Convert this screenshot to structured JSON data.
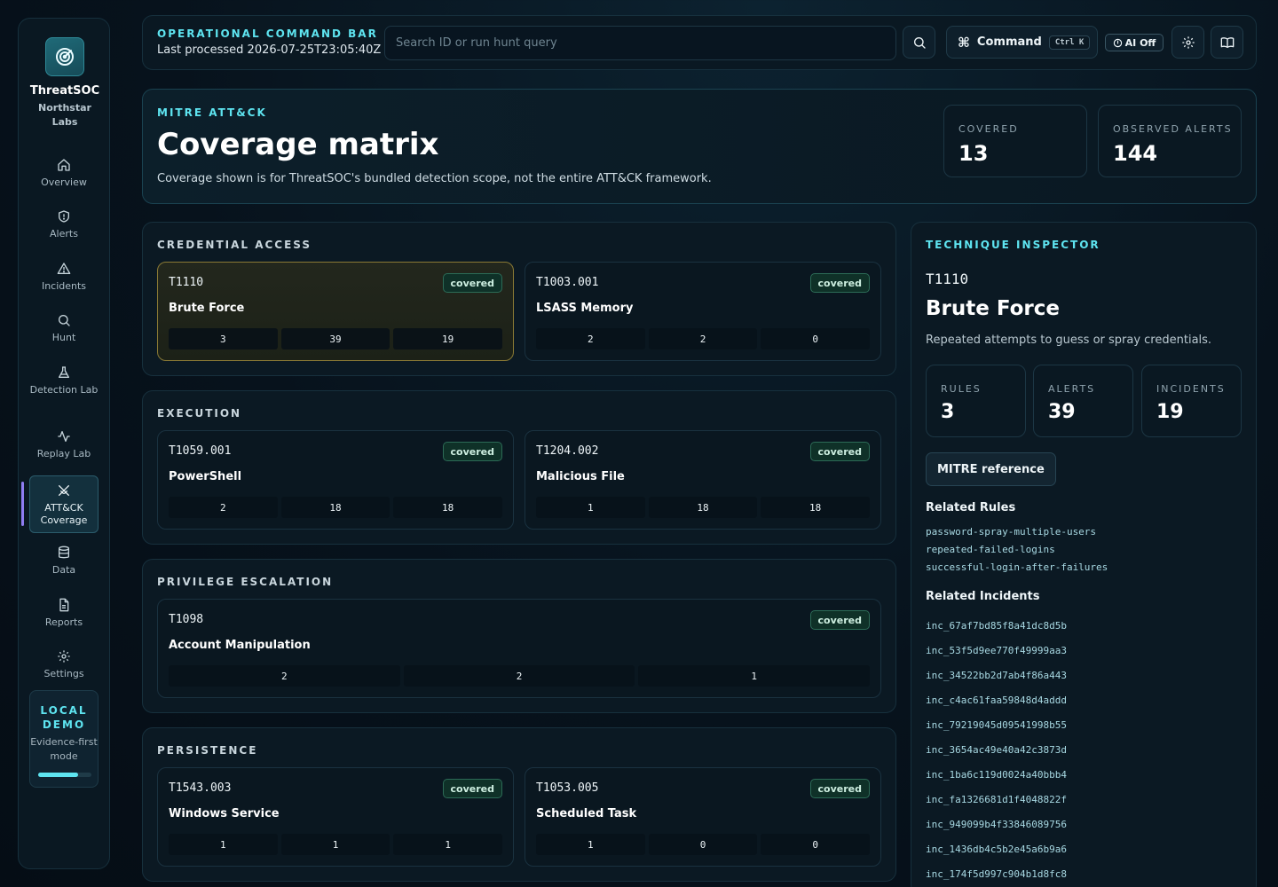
{
  "brand": {
    "name": "ThreatSOC",
    "org_line1": "Northstar",
    "org_line2": "Labs"
  },
  "nav": [
    {
      "label": "Overview",
      "icon": "home-icon"
    },
    {
      "label": "Alerts",
      "icon": "shield-icon"
    },
    {
      "label": "Incidents",
      "icon": "warning-icon"
    },
    {
      "label": "Hunt",
      "icon": "search-icon"
    },
    {
      "label": "Detection Lab",
      "icon": "flask-icon"
    },
    {
      "label": "Replay Lab",
      "icon": "activity-icon"
    },
    {
      "label": "ATT&CK Coverage",
      "icon": "swords-icon",
      "active": true
    },
    {
      "label": "Data",
      "icon": "database-icon"
    },
    {
      "label": "Reports",
      "icon": "file-icon"
    },
    {
      "label": "Settings",
      "icon": "gear-icon"
    }
  ],
  "demo": {
    "title": "LOCAL DEMO",
    "subtitle": "Evidence-first mode",
    "progress": 0.75
  },
  "topbar": {
    "title": "OPERATIONAL COMMAND BAR",
    "last_processed": "Last processed 2026-07-25T23:05:40Z",
    "search_placeholder": "Search ID or run hunt query",
    "command_label": "Command",
    "command_shortcut": "Ctrl K",
    "ai_label": "AI Off"
  },
  "hero": {
    "tag": "MITRE ATT&CK",
    "title": "Coverage matrix",
    "description": "Coverage shown is for ThreatSOC's bundled detection scope, not the entire ATT&CK framework.",
    "stats": [
      {
        "label": "COVERED",
        "value": "13"
      },
      {
        "label": "OBSERVED ALERTS",
        "value": "144"
      }
    ]
  },
  "tactics": [
    {
      "name": "CREDENTIAL ACCESS",
      "techniques": [
        {
          "id": "T1110",
          "name": "Brute Force",
          "status": "covered",
          "metrics": [
            "3",
            "39",
            "19"
          ],
          "selected": true
        },
        {
          "id": "T1003.001",
          "name": "LSASS Memory",
          "status": "covered",
          "metrics": [
            "2",
            "2",
            "0"
          ]
        }
      ]
    },
    {
      "name": "EXECUTION",
      "techniques": [
        {
          "id": "T1059.001",
          "name": "PowerShell",
          "status": "covered",
          "metrics": [
            "2",
            "18",
            "18"
          ]
        },
        {
          "id": "T1204.002",
          "name": "Malicious File",
          "status": "covered",
          "metrics": [
            "1",
            "18",
            "18"
          ]
        }
      ]
    },
    {
      "name": "PRIVILEGE ESCALATION",
      "techniques": [
        {
          "id": "T1098",
          "name": "Account Manipulation",
          "status": "covered",
          "metrics": [
            "2",
            "2",
            "1"
          ]
        }
      ]
    },
    {
      "name": "PERSISTENCE",
      "techniques": [
        {
          "id": "T1543.003",
          "name": "Windows Service",
          "status": "covered",
          "metrics": [
            "1",
            "1",
            "1"
          ]
        },
        {
          "id": "T1053.005",
          "name": "Scheduled Task",
          "status": "covered",
          "metrics": [
            "1",
            "0",
            "0"
          ]
        }
      ]
    }
  ],
  "inspector": {
    "tag": "TECHNIQUE INSPECTOR",
    "id": "T1110",
    "name": "Brute Force",
    "description": "Repeated attempts to guess or spray credentials.",
    "stats": [
      {
        "label": "RULES",
        "value": "3"
      },
      {
        "label": "ALERTS",
        "value": "39"
      },
      {
        "label": "INCIDENTS",
        "value": "19"
      }
    ],
    "mitre_button": "MITRE reference",
    "rules_heading": "Related Rules",
    "rules": [
      "password-spray-multiple-users",
      "repeated-failed-logins",
      "successful-login-after-failures"
    ],
    "incidents_heading": "Related Incidents",
    "incidents": [
      "inc_67af7bd85f8a41dc8d5b",
      "inc_53f5d9ee770f49999aa3",
      "inc_34522bb2d7ab4f86a443",
      "inc_c4ac61faa59848d4addd",
      "inc_79219045d09541998b55",
      "inc_3654ac49e40a42c3873d",
      "inc_1ba6c119d0024a40bbb4",
      "inc_fa1326681d1f4048822f",
      "inc_949099b4f33846089756",
      "inc_1436db4c5b2e45a6b9a6",
      "inc_174f5d997c904b1d8fc8"
    ]
  },
  "colors": {
    "accent": "#5ee4f0",
    "covered_bg": "#0f3128",
    "selected_border": "#8a7a35",
    "active_marker": "#8f7cf0"
  }
}
